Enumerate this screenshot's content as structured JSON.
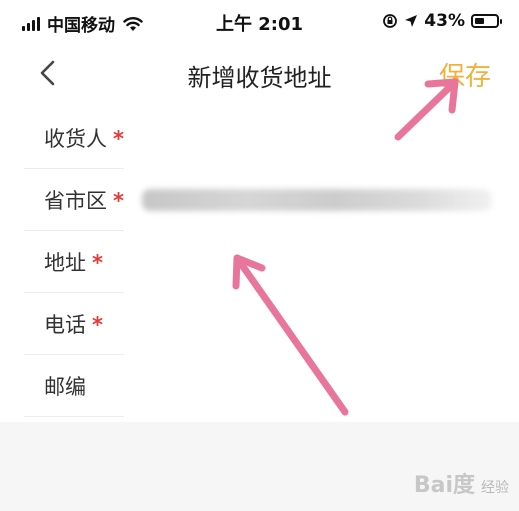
{
  "status_bar": {
    "carrier": "中国移动",
    "time": "上午 2:01",
    "battery": "43%",
    "battery_level": 0.43
  },
  "header": {
    "title": "新增收货地址",
    "save_label": "保存"
  },
  "form": {
    "fields": [
      {
        "label": "收货人",
        "required": "*"
      },
      {
        "label": "省市区",
        "required": "*"
      },
      {
        "label": "地址",
        "required": "*"
      },
      {
        "label": "电话",
        "required": "*"
      },
      {
        "label": "邮编",
        "required": ""
      }
    ]
  },
  "watermark": {
    "brand": "Bai度",
    "sub": "经验"
  },
  "colors": {
    "accent": "#f2b23a",
    "required": "#e53935",
    "annotation_arrow": "#e8769a"
  }
}
